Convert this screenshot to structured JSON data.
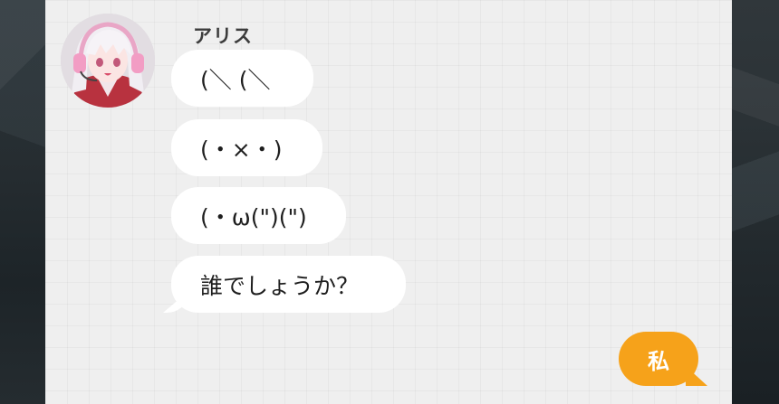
{
  "chat": {
    "sender_name": "アリス",
    "messages": [
      {
        "text": "(＼ (＼"
      },
      {
        "text": "(・×・)"
      },
      {
        "text": "(・ω(\")(\")"
      },
      {
        "text": "誰でしょうか？"
      }
    ],
    "reply_option": "私"
  },
  "colors": {
    "panel_background": "#efefef",
    "bubble_background": "#ffffff",
    "reply_background": "#f6a21a",
    "reply_text": "#ffffff"
  },
  "icons": {
    "avatar": "anime-girl-avatar"
  }
}
